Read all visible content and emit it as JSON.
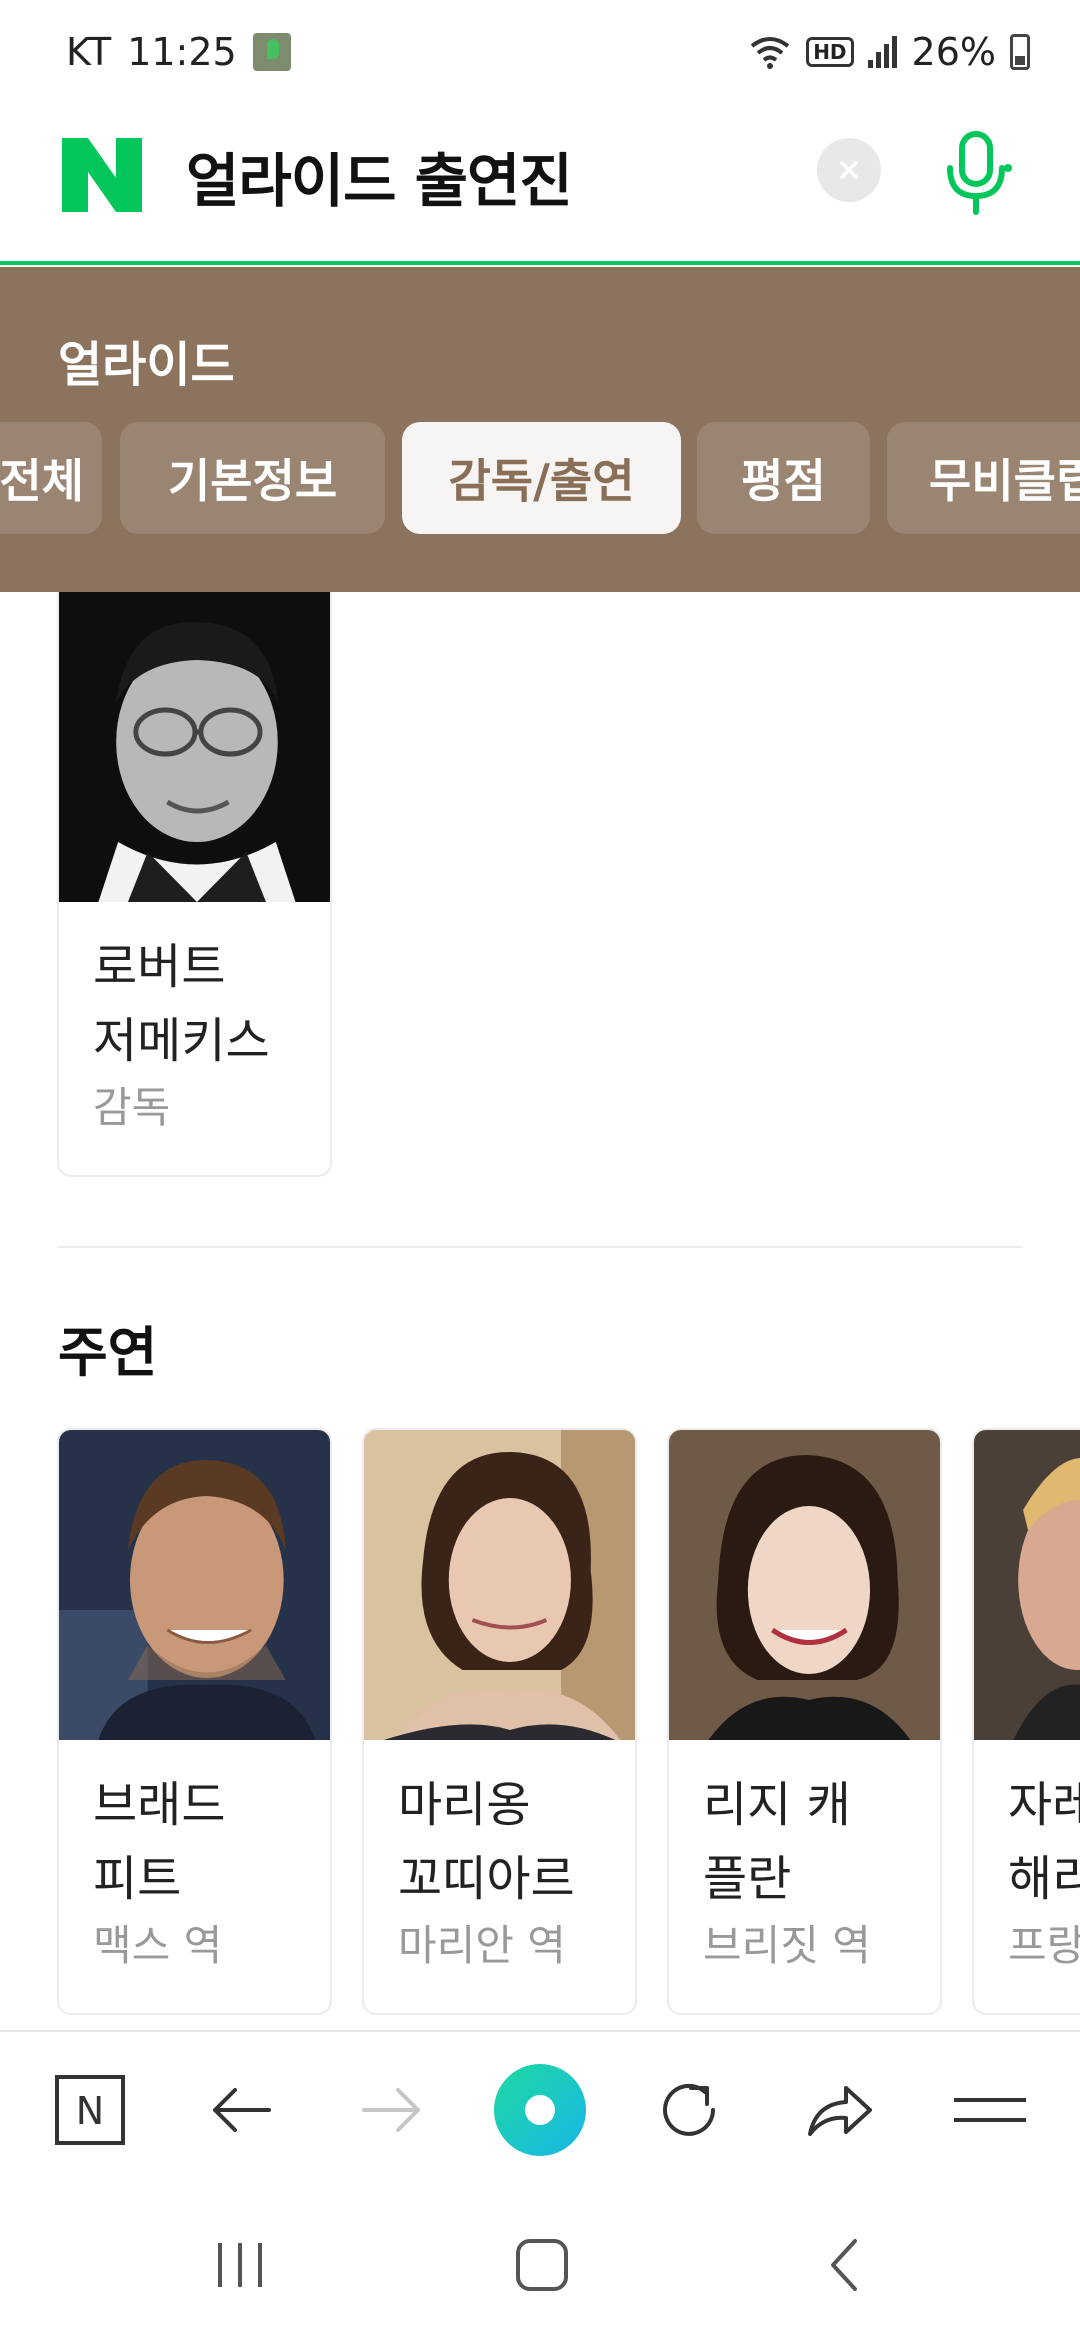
{
  "status_bar": {
    "carrier": "KT",
    "time": "11:25",
    "battery": "26%"
  },
  "search": {
    "logo_letter": "N",
    "query": "얼라이드 출연진"
  },
  "movie": {
    "title": "얼라이드",
    "tabs": [
      {
        "label": "전체",
        "visible_text": "전체",
        "active": false
      },
      {
        "label": "기본정보",
        "active": false
      },
      {
        "label": "감독/출연",
        "active": true
      },
      {
        "label": "평점",
        "active": false
      },
      {
        "label": "무비클립",
        "visible_text": "무비클립",
        "active": false
      }
    ]
  },
  "director": {
    "name_line1": "로버트",
    "name_line2": "저메키스",
    "role": "감독"
  },
  "cast_section_title": "주연",
  "cast": [
    {
      "name_line1": "브래드",
      "name_line2": "피트",
      "role": "맥스 역"
    },
    {
      "name_line1": "마리옹",
      "name_line2": "꼬띠아르",
      "role": "마리안 역"
    },
    {
      "name_line1": "리지 캐",
      "name_line2": "플란",
      "role": "브리짓 역"
    },
    {
      "name_line1": "자레",
      "name_line2": "해리",
      "role": "프랑"
    }
  ],
  "colors": {
    "naver_green": "#03c75a",
    "panel_brown": "#8c735d",
    "active_tab_text": "#8a6f58"
  },
  "icons": {
    "toolbar": [
      "naver-home-icon",
      "back-arrow-icon",
      "forward-arrow-icon",
      "green-dot-icon",
      "refresh-icon",
      "share-icon",
      "menu-icon"
    ],
    "nav": [
      "recent-apps-icon",
      "home-icon",
      "back-icon"
    ]
  }
}
